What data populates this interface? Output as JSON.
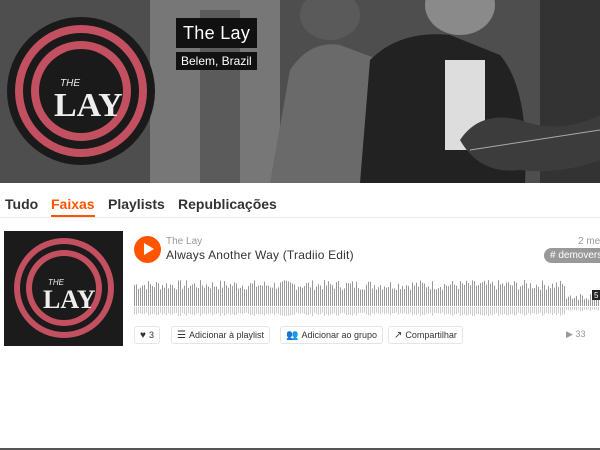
{
  "artist": {
    "name": "The Lay",
    "location": "Belem, Brazil",
    "logo_text": "THE LAY"
  },
  "tabs": [
    {
      "label": "Tudo",
      "active": false
    },
    {
      "label": "Faixas",
      "active": true
    },
    {
      "label": "Playlists",
      "active": false
    },
    {
      "label": "Republicações",
      "active": false
    }
  ],
  "track": {
    "uploader": "The Lay",
    "title": "Always Another Way (Tradiio Edit)",
    "date_partial": "2 me",
    "tag": "# demoversio",
    "likes": "3",
    "add_to_playlist": "Adicionar à playlist",
    "add_to_group": "Adicionar ao grupo",
    "share": "Compartilhar",
    "plays": "33",
    "duration_partial": "5",
    "progress": 0
  },
  "colors": {
    "accent": "#ff5500",
    "text": "#333333",
    "muted": "#999999",
    "header_bg": "#3a3a3a",
    "cover_red": "#c25060"
  },
  "icons": [
    "play-icon",
    "heart-icon",
    "add-to-playlist-icon",
    "add-to-group-icon",
    "share-icon",
    "plays-icon"
  ]
}
